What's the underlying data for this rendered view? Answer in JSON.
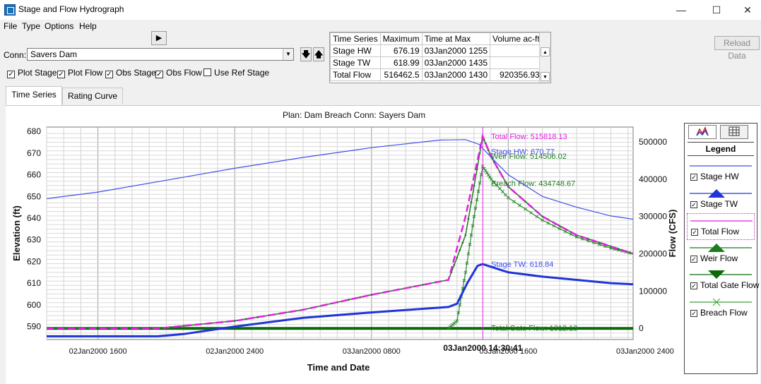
{
  "window": {
    "title": "Stage and Flow Hydrograph",
    "minimize": "—",
    "maximize": "☐",
    "close": "✕"
  },
  "menu": [
    "File",
    "Type",
    "Options",
    "Help"
  ],
  "toolbar": {
    "play_icon": "▶",
    "conn_label": "Conn:",
    "conn_value": "Savers Dam",
    "down_icon": "🡇",
    "up_icon": "🡅",
    "reload_label": "Reload Data"
  },
  "checkboxes": [
    {
      "label": "Plot Stage",
      "checked": true
    },
    {
      "label": "Plot Flow",
      "checked": true
    },
    {
      "label": "Obs Stage",
      "checked": true
    },
    {
      "label": "Obs Flow",
      "checked": true
    },
    {
      "label": "Use Ref Stage",
      "checked": false
    }
  ],
  "summary_table": {
    "headers": [
      "Time Series",
      "Maximum",
      "Time at Max",
      "Volume ac-ft"
    ],
    "rows": [
      [
        "Stage HW",
        "676.19",
        "03Jan2000 1255",
        ""
      ],
      [
        "Stage TW",
        "618.99",
        "03Jan2000 1435",
        ""
      ],
      [
        "Total Flow",
        "516462.5",
        "03Jan2000 1430",
        "920356.93"
      ]
    ]
  },
  "tabs": [
    "Time Series",
    "Rating Curve"
  ],
  "legend": {
    "title": "Legend",
    "items": [
      {
        "label": "Stage HW",
        "color": "#3f4fe8",
        "marker": "none",
        "checked": true
      },
      {
        "label": "Stage TW",
        "color": "#1f35d6",
        "marker": "triangle-up",
        "checked": true
      },
      {
        "label": "Total Flow",
        "color": "#e020e0",
        "marker": "none",
        "checked": true
      },
      {
        "label": "Weir Flow",
        "color": "#1e7a1e",
        "marker": "triangle-up",
        "checked": true
      },
      {
        "label": "Total Gate Flow",
        "color": "#0a6a0a",
        "marker": "triangle-down",
        "checked": true
      },
      {
        "label": "Breach Flow",
        "color": "#3aa23a",
        "marker": "x",
        "checked": true
      }
    ]
  },
  "chart_data": {
    "type": "line",
    "title": "Plan: Dam Breach      Conn: Sayers Dam",
    "xlabel": "Time and Date",
    "ylabel_left": "Elevation (ft)",
    "ylabel_right": "Flow (CFS)",
    "x_unit": "hours after 02Jan2000 0000",
    "xlim": [
      13.0,
      47.3
    ],
    "x_ticks": [
      {
        "x": 16,
        "label": "02Jan2000 1600"
      },
      {
        "x": 24,
        "label": "02Jan2000 2400"
      },
      {
        "x": 32,
        "label": "03Jan2000 0800"
      },
      {
        "x": 40,
        "label": "03Jan2000 1600"
      },
      {
        "x": 48,
        "label": "03Jan2000 2400"
      }
    ],
    "cursor": {
      "x": 38.508,
      "label": "03Jan2000 14:30:41"
    },
    "ylim_left": [
      584,
      682
    ],
    "yticks_left": [
      590,
      600,
      610,
      620,
      630,
      640,
      650,
      660,
      670,
      680
    ],
    "ylim_right": [
      -30000,
      540000
    ],
    "yticks_right": [
      0,
      100000,
      200000,
      300000,
      400000,
      500000
    ],
    "series": [
      {
        "name": "Stage HW",
        "axis": "left",
        "color": "#3f4fe8",
        "width": 1.2,
        "x": [
          13,
          16,
          20,
          24,
          28,
          32,
          36,
          37.5,
          38.3,
          39,
          40,
          42,
          44,
          46,
          47.3
        ],
        "y": [
          649,
          652,
          657.5,
          663,
          668,
          672.5,
          676,
          676.2,
          674,
          668,
          660,
          650,
          645,
          641,
          639.5
        ]
      },
      {
        "name": "Stage TW",
        "axis": "left",
        "color": "#1f35d6",
        "width": 3,
        "x": [
          13,
          19.5,
          21,
          24,
          28,
          32,
          36.5,
          37,
          37.6,
          38.2,
          38.5,
          39,
          40,
          42,
          44,
          46,
          47.3
        ],
        "y": [
          585.5,
          585.5,
          586.5,
          590,
          594,
          596.5,
          599,
          600.5,
          610,
          618,
          618.8,
          617.5,
          615,
          613,
          611.5,
          610,
          609.5
        ]
      },
      {
        "name": "Total Flow",
        "axis": "right",
        "color": "#e020e0",
        "width": 2.5,
        "dash": "10,5",
        "x": [
          13,
          19.5,
          24,
          28,
          32,
          36.5,
          37.5,
          38.5,
          39,
          40,
          42,
          44,
          46,
          47.3
        ],
        "y": [
          0,
          0,
          20000,
          50000,
          90000,
          130000,
          300000,
          515818,
          460000,
          380000,
          300000,
          250000,
          220000,
          200000
        ]
      },
      {
        "name": "Weir Flow",
        "axis": "right",
        "color": "#1e7a1e",
        "width": 1.5,
        "marker": "dot",
        "x": [
          13,
          19.5,
          24,
          28,
          32,
          36.5,
          37.5,
          38.5,
          39,
          40,
          42,
          44,
          46,
          47.3
        ],
        "y": [
          0,
          0,
          20000,
          50000,
          90000,
          130000,
          250000,
          514506,
          460000,
          380000,
          300000,
          250000,
          220000,
          200000
        ]
      },
      {
        "name": "Breach Flow",
        "axis": "right",
        "color": "#2b8a2b",
        "width": 1.2,
        "marker": "x",
        "x": [
          36.5,
          37,
          37.5,
          38,
          38.5,
          39,
          40,
          42,
          44,
          46,
          47.3
        ],
        "y": [
          0,
          20000,
          150000,
          300000,
          434748,
          400000,
          350000,
          290000,
          245000,
          215000,
          200000
        ]
      },
      {
        "name": "Total Gate Flow",
        "axis": "right",
        "color": "#0a6a0a",
        "width": 4,
        "x": [
          13,
          47.3
        ],
        "y": [
          0,
          0
        ]
      }
    ],
    "annotations": [
      {
        "text": "Total Flow: 515818.13",
        "color": "#e020e0",
        "x": 38.5,
        "y": 515818
      },
      {
        "text": "Weir Flow: 514506.02",
        "color": "#1e7a1e",
        "x": 38.5,
        "y": 462000
      },
      {
        "text": "Stage HW: 670.77",
        "color": "#3f4fe8",
        "x": 38.5,
        "y": 670.77,
        "axis": "left"
      },
      {
        "text": "Breach Flow: 434748.67",
        "color": "#1e7a1e",
        "x": 38.5,
        "y": 389000
      },
      {
        "text": "Stage TW: 618.84",
        "color": "#3f4fe8",
        "x": 38.5,
        "y": 618.84,
        "axis": "left"
      },
      {
        "text": "Total Gate Flow: 1312.13",
        "color": "#1e7a1e",
        "x": 38.5,
        "y": 1312
      }
    ]
  }
}
